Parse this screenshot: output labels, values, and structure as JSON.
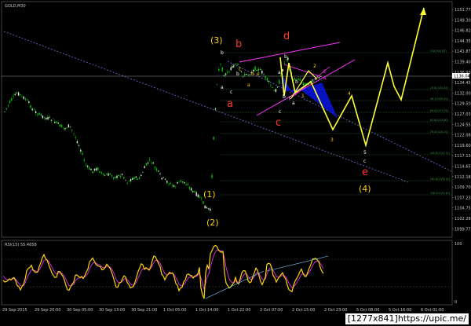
{
  "window": {
    "main_title": "GOLD,M30",
    "indicator_title": "RSI(15) 55.4658",
    "current_price_tag": "1136.04"
  },
  "watermark": "[1277x841]https://upic.me/",
  "colors": {
    "background": "#000000",
    "bull_candle": "#00cc00",
    "wave_labels": "#ffd400",
    "correction_labels": "#ff3b2e",
    "impulse_projection": "#ffff33",
    "channel": "#ff33ff",
    "triangle_fill": "#0a14d8",
    "rsi_line": "#ffd400",
    "rsi_signal": "#ff33ff"
  },
  "price_axis": [
    "1151.77",
    "1149.30",
    "1146.82",
    "1144.35",
    "1141.87",
    "1139.40",
    "1136.93",
    "1134.45",
    "1132.00",
    "1129.50",
    "1127.03",
    "1124.55",
    "1122.08",
    "1119.60",
    "1117.13",
    "1114.65",
    "1112.18",
    "1109.70",
    "1107.23",
    "1104.75",
    "1102.28",
    "1099.77"
  ],
  "rsi_axis": [
    "100",
    "0"
  ],
  "time_axis": [
    "29 Sep 2015",
    "29 Sep 20:00",
    "30 Sep 05:00",
    "30 Sep 13:00",
    "30 Sep 21:00",
    "1 Oct 05:00",
    "1 Oct 14:00",
    "1 Oct 22:00",
    "2 Oct 07:00",
    "2 Oct 15:00",
    "2 Oct 23:00",
    "5 Oct 08:00",
    "5 Oct 16:00",
    "6 Oct 01:00"
  ],
  "fib_labels": [
    "0.0(1141.87)",
    "23.6(1134.45)",
    "38.2(1130.20)",
    "50.0(1127.03)",
    "61.8(1123.80)",
    "76.4(1120.10)",
    "100.0(1113.71)",
    "161.8(1108.20)",
    "138.2(1103.40)"
  ],
  "wave_labels": {
    "w1": "(1)",
    "w2": "(2)",
    "w3": "(3)",
    "w4": "(4)",
    "a": "a",
    "b": "b",
    "c": "c",
    "d": "d",
    "e": "e",
    "sub_a": "a",
    "sub_b": "b",
    "sub_c": "c",
    "sub_d": "d",
    "sub_e": "e",
    "p1": "1",
    "p2": "2",
    "p3": "3",
    "p4": "4",
    "p5": "5"
  }
}
